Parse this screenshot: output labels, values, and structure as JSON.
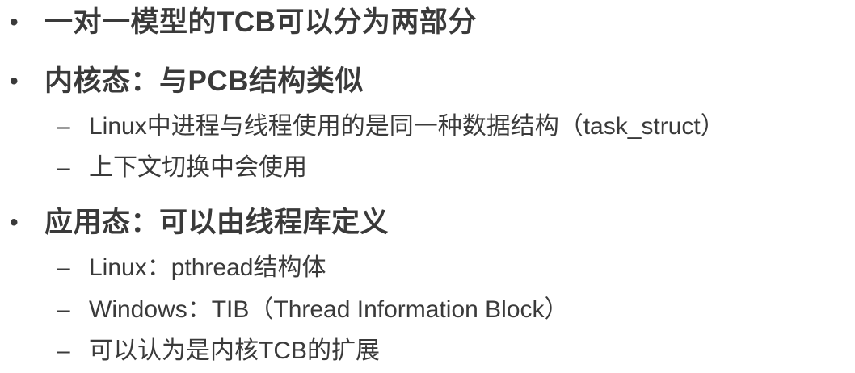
{
  "bullets": [
    {
      "symbol": "•",
      "text": "一对一模型的TCB可以分为两部分",
      "subs": []
    },
    {
      "symbol": "•",
      "text": "内核态：与PCB结构类似",
      "subs": [
        {
          "symbol": "–",
          "text": "Linux中进程与线程使用的是同一种数据结构（task_struct）"
        },
        {
          "symbol": "–",
          "text": "上下文切换中会使用"
        }
      ]
    },
    {
      "symbol": "•",
      "text": "应用态：可以由线程库定义",
      "subs": [
        {
          "symbol": "–",
          "text": "Linux：pthread结构体"
        },
        {
          "symbol": "–",
          "text": "Windows：TIB（Thread Information Block）"
        },
        {
          "symbol": "–",
          "text": "可以认为是内核TCB的扩展"
        }
      ]
    }
  ]
}
